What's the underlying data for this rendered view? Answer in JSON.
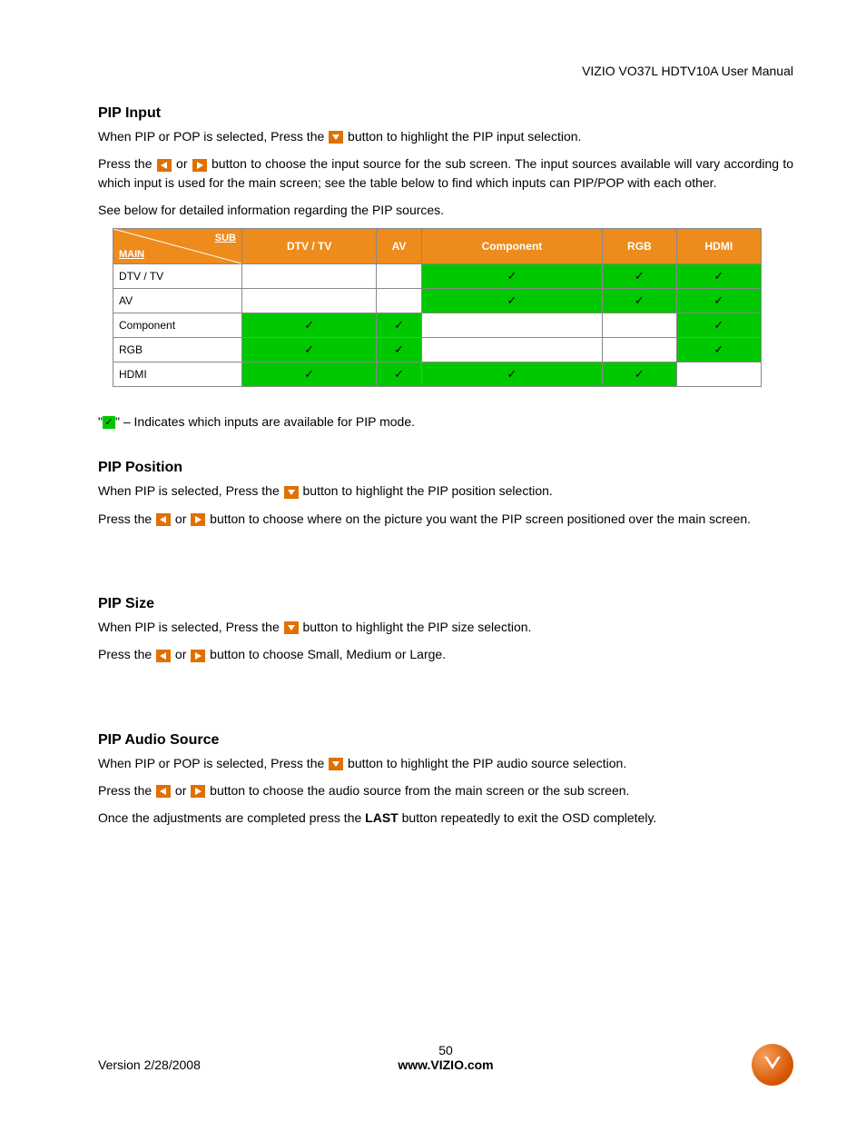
{
  "header": {
    "title": "VIZIO VO37L HDTV10A User Manual"
  },
  "sections": {
    "pip_input": {
      "heading": "PIP Input",
      "p1a": "When PIP or POP is selected, Press the ",
      "p1b": " button to highlight the PIP input selection.",
      "p2a": "Press the ",
      "p2or": " or ",
      "p2b": " button to choose the input source for the sub screen. The input sources available will vary according to which input is used for the main screen; see the table below to find which inputs can PIP/POP with each other.",
      "p3": "See below for detailed information regarding the PIP sources.",
      "legend_a": "\"",
      "legend_b": "\" – Indicates which inputs are available for PIP mode."
    },
    "pip_position": {
      "heading": "PIP Position",
      "p1a": "When PIP is selected, Press the ",
      "p1b": " button to highlight the PIP position selection.",
      "p2a": "Press the ",
      "p2or": " or ",
      "p2b": " button to choose where on the picture you want the PIP screen positioned over the main screen."
    },
    "pip_size": {
      "heading": "PIP Size",
      "p1a": "When PIP is selected, Press the ",
      "p1b": " button to highlight the PIP size selection.",
      "p2a": "Press the ",
      "p2or": " or ",
      "p2b": " button to choose Small, Medium or Large."
    },
    "pip_audio": {
      "heading": "PIP Audio Source",
      "p1a": "When PIP or POP is selected, Press the ",
      "p1b": " button to highlight the PIP audio source selection.",
      "p2a": "Press the ",
      "p2or": " or ",
      "p2b": " button to choose the audio source from the main screen or the sub screen.",
      "p3a": "Once the adjustments are completed press the ",
      "p3bold": "LAST",
      "p3b": " button repeatedly to exit the OSD completely."
    }
  },
  "table": {
    "corner_sub": "SUB",
    "corner_main": "MAIN",
    "columns": [
      "DTV / TV",
      "AV",
      "Component",
      "RGB",
      "HDMI"
    ],
    "rows": [
      {
        "label": "DTV / TV",
        "cells": [
          false,
          false,
          true,
          true,
          true
        ]
      },
      {
        "label": "AV",
        "cells": [
          false,
          false,
          true,
          true,
          true
        ]
      },
      {
        "label": "Component",
        "cells": [
          true,
          true,
          false,
          false,
          true
        ]
      },
      {
        "label": "RGB",
        "cells": [
          true,
          true,
          false,
          false,
          true
        ]
      },
      {
        "label": "HDMI",
        "cells": [
          true,
          true,
          true,
          true,
          false
        ]
      }
    ],
    "checkmark": "✓"
  },
  "footer": {
    "version": "Version 2/28/2008",
    "page": "50",
    "url": "www.VIZIO.com"
  },
  "colors": {
    "orange": "#ed8b1c",
    "green": "#00c800"
  }
}
